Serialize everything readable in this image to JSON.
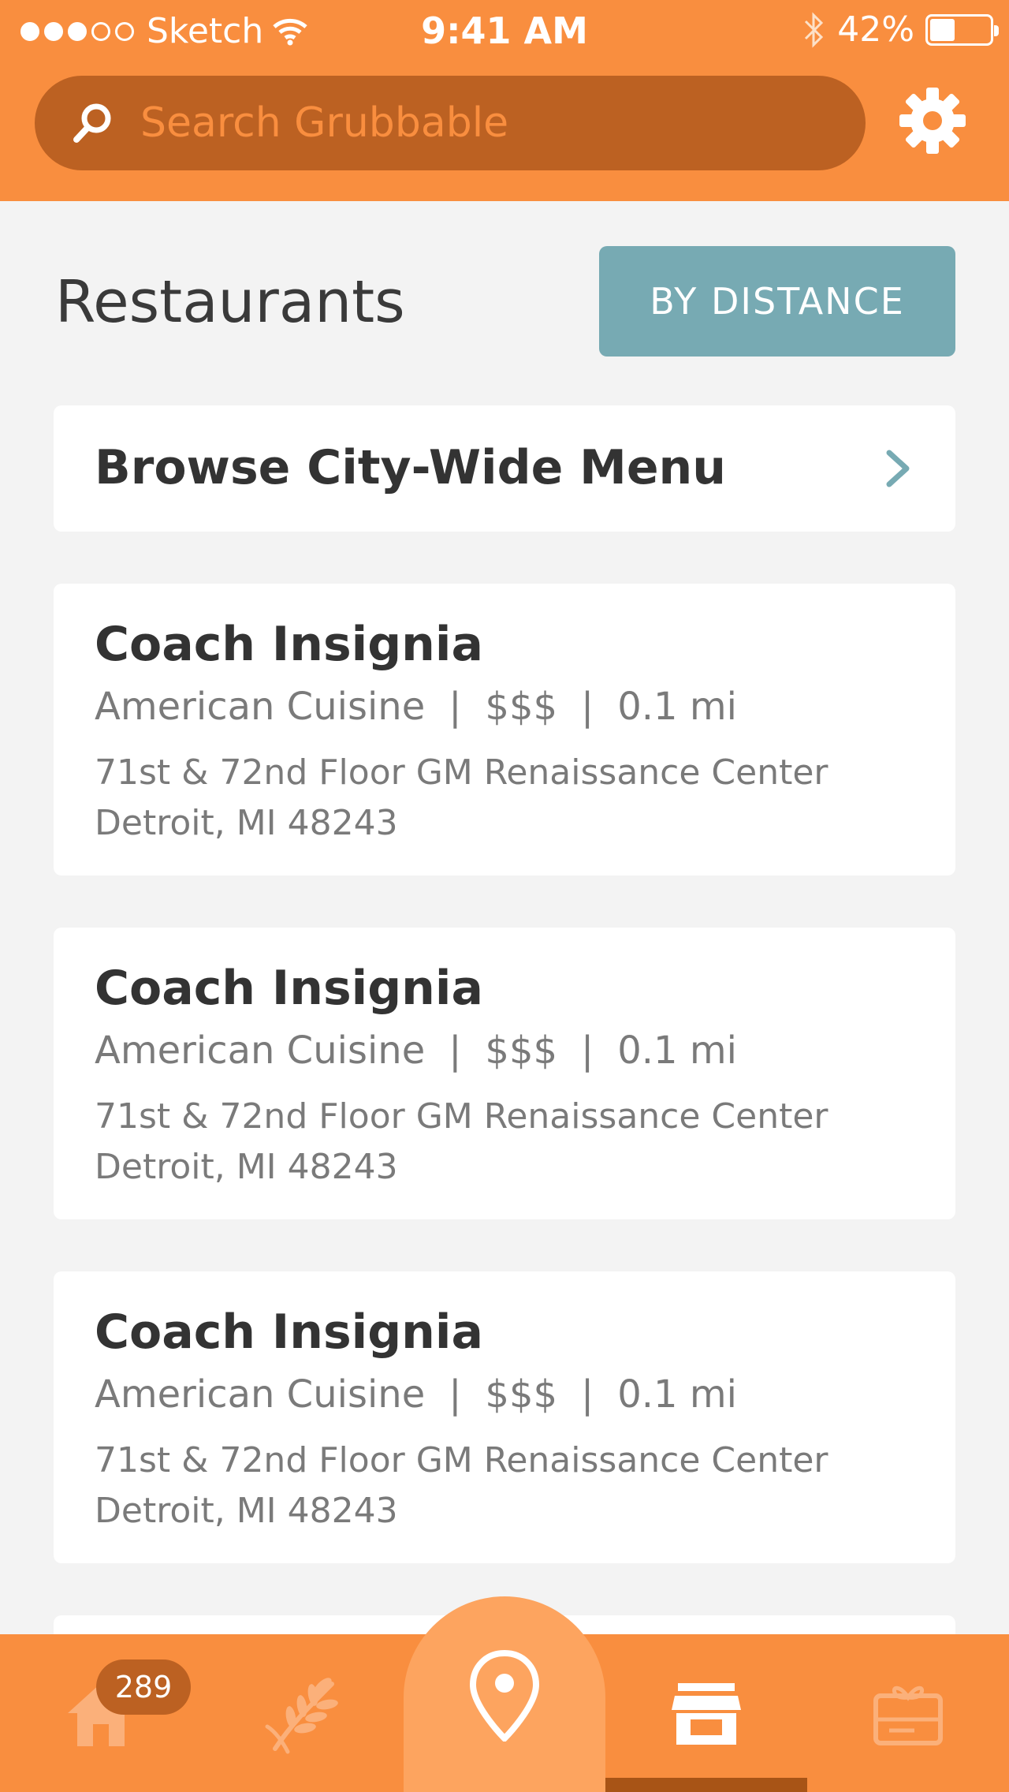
{
  "status_bar": {
    "carrier": "Sketch",
    "time": "9:41 AM",
    "battery": "42%",
    "battery_level": 0.42,
    "signal_bars_filled": 3,
    "signal_bars_total": 5
  },
  "search": {
    "placeholder": "Search Grubbable"
  },
  "page": {
    "title": "Restaurants",
    "sort_label": "BY DISTANCE",
    "browse_label": "Browse City-Wide Menu"
  },
  "restaurants": [
    {
      "name": "Coach Insignia",
      "cuisine": "American Cuisine",
      "price": "$$$",
      "distance": "0.1 mi",
      "address_line1": "71st & 72nd Floor GM Renaissance Center",
      "address_line2": "Detroit, MI 48243"
    },
    {
      "name": "Coach Insignia",
      "cuisine": "American Cuisine",
      "price": "$$$",
      "distance": "0.1 mi",
      "address_line1": "71st & 72nd Floor GM Renaissance Center",
      "address_line2": "Detroit, MI 48243"
    },
    {
      "name": "Coach Insignia",
      "cuisine": "American Cuisine",
      "price": "$$$",
      "distance": "0.1 mi",
      "address_line1": "71st & 72nd Floor GM Renaissance Center",
      "address_line2": "Detroit, MI 48243"
    }
  ],
  "separator": "|",
  "tab_bar": {
    "home_badge": "289",
    "tabs": [
      "home-icon",
      "wheat-icon",
      "location-pin-icon",
      "store-icon",
      "gift-card-icon"
    ],
    "active_tab": "store-icon"
  },
  "colors": {
    "brand_orange": "#f98e3f",
    "dark_orange": "#bc6122",
    "teal": "#77aab3",
    "background": "#f3f3f3"
  }
}
